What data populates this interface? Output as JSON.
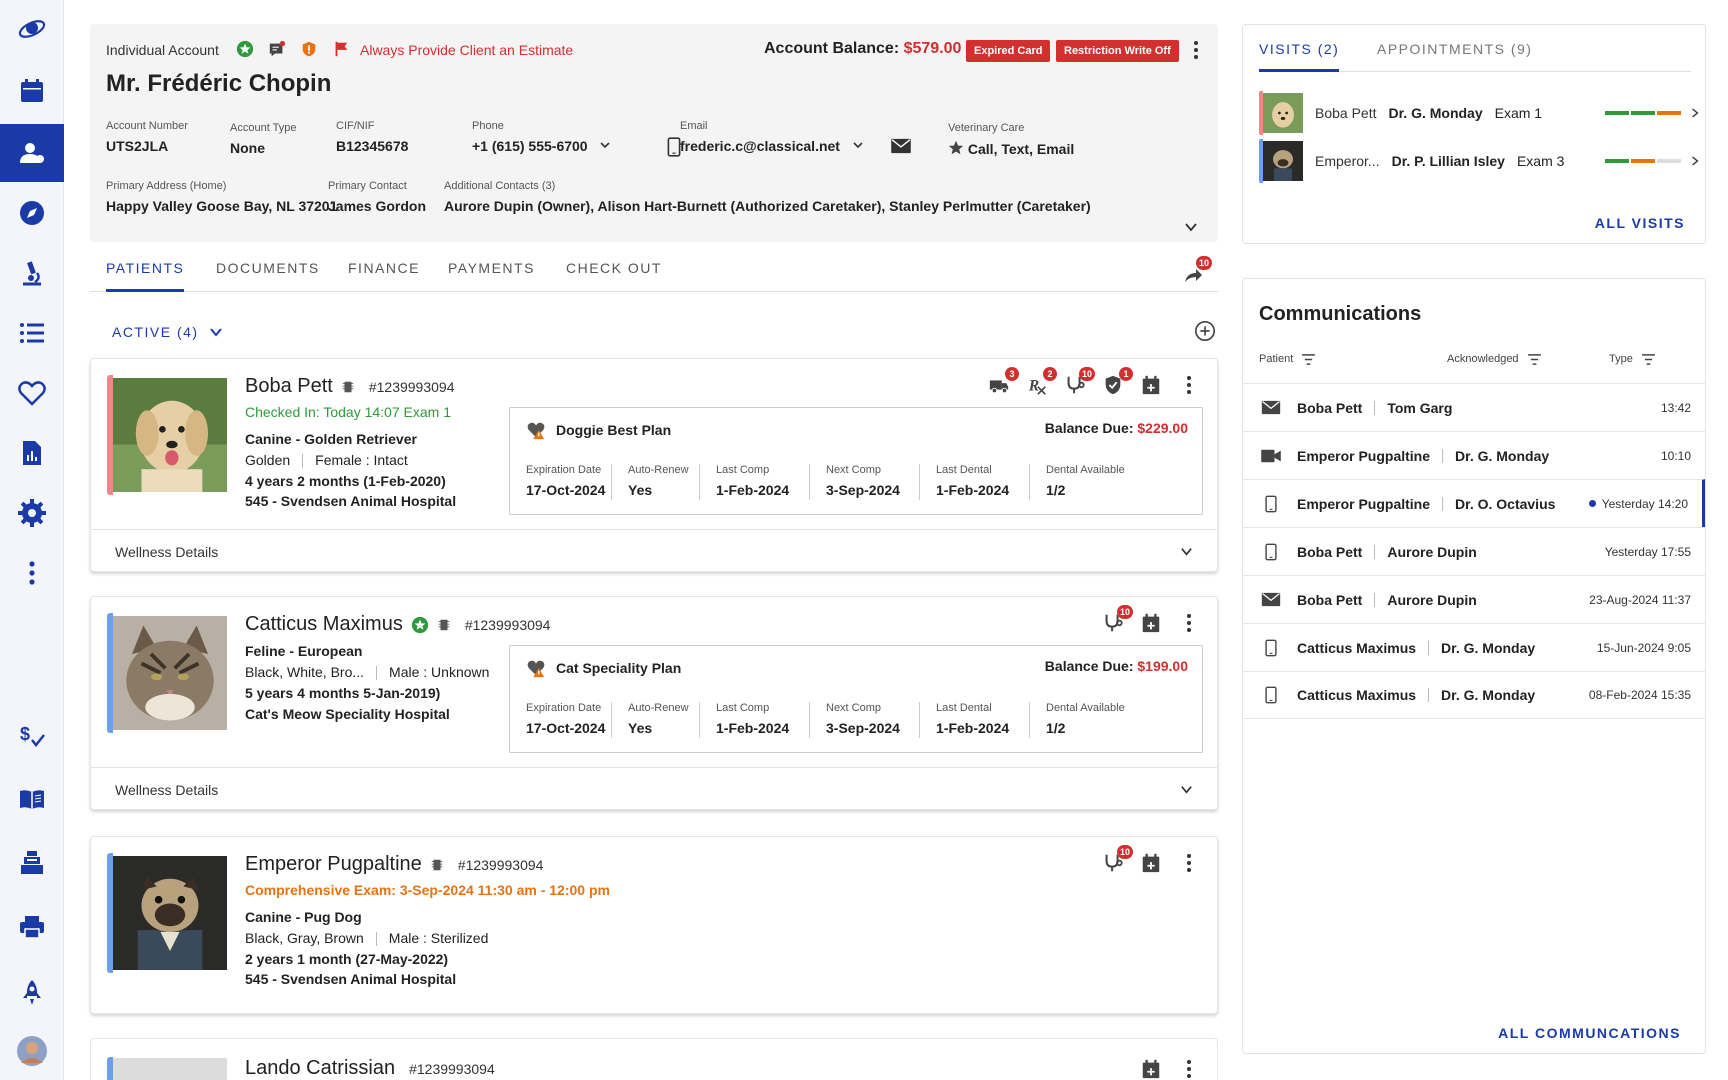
{
  "colors": {
    "brand": "#1a3aa8",
    "alert": "#d32f2f",
    "success": "#2e9a3c",
    "warning": "#e87312"
  },
  "nav": {
    "items": [
      "logo-icon",
      "calendar-icon",
      "client-icon",
      "compass-icon",
      "microscope-icon",
      "list-icon",
      "heart-icon",
      "report-icon",
      "settings-icon",
      "more-icon",
      "billing-icon",
      "library-icon",
      "register-icon",
      "printer-icon",
      "launch-icon",
      "avatar"
    ]
  },
  "account": {
    "type": "Individual Account",
    "estimate": "Always Provide Client an Estimate",
    "name": "Mr. Frédéric Chopin",
    "balance_label": "Account Balance:",
    "balance": "$579.00",
    "badge_expired": "Expired Card",
    "badge_restriction": "Restriction Write Off",
    "account_number_label": "Account Number",
    "account_number": "UTS2JLA",
    "account_type_label": "Account Type",
    "account_type": "None",
    "cif_label": "CIF/NIF",
    "cif": "B12345678",
    "phone_label": "Phone",
    "phone": "+1 (615) 555-6700",
    "email_label": "Email",
    "email": "frederic.c@classical.net",
    "vet_care_label": "Veterinary Care",
    "vet_care": "Call, Text, Email",
    "address_label": "Primary Address (Home)",
    "address": "Happy Valley Goose Bay, NL 37201",
    "primary_contact_label": "Primary Contact",
    "primary_contact": "James Gordon",
    "additional_contacts_label": "Additional Contacts (3)",
    "additional_contacts": "Aurore Dupin (Owner), Alison Hart-Burnett (Authorized Caretaker), Stanley Perlmutter (Caretaker)"
  },
  "tabs": [
    "PATIENTS",
    "DOCUMENTS",
    "FINANCE",
    "PAYMENTS",
    "CHECK OUT"
  ],
  "share_count": "10",
  "filter": "ACTIVE (4)",
  "patients": [
    {
      "name": "Boba Pett",
      "id": "#1239993094",
      "status": "Checked In: Today 14:07 Exam 1",
      "species": "Canine - Golden Retriever",
      "color": "Golden",
      "sex": "Female : Intact",
      "age": "4 years 2 months (1-Feb-2020)",
      "hospital": "545 - Svendsen Animal Hospital",
      "counts": {
        "truck": "3",
        "rx": "2",
        "stetho": "10",
        "shield": "1"
      },
      "plan": {
        "name": "Doggie Best Plan",
        "balance_label": "Balance Due:",
        "balance": "$229.00",
        "cols": [
          {
            "label": "Expiration Date",
            "value": "17-Oct-2024"
          },
          {
            "label": "Auto-Renew",
            "value": "Yes"
          },
          {
            "label": "Last Comp",
            "value": "1-Feb-2024"
          },
          {
            "label": "Next Comp",
            "value": "3-Sep-2024"
          },
          {
            "label": "Last Dental",
            "value": "1-Feb-2024"
          },
          {
            "label": "Dental Available",
            "value": "1/2"
          }
        ]
      },
      "wellness": "Wellness Details"
    },
    {
      "name": "Catticus Maximus",
      "id": "#1239993094",
      "species": "Feline - European",
      "color": "Black, White, Bro...",
      "sex": "Male : Unknown",
      "age": "5 years 4 months  5-Jan-2019)",
      "hospital": "Cat's Meow Speciality Hospital",
      "counts": {
        "stetho": "10"
      },
      "plan": {
        "name": "Cat Speciality Plan",
        "balance_label": "Balance Due:",
        "balance": "$199.00",
        "cols": [
          {
            "label": "Expiration Date",
            "value": "17-Oct-2024"
          },
          {
            "label": "Auto-Renew",
            "value": "Yes"
          },
          {
            "label": "Last Comp",
            "value": "1-Feb-2024"
          },
          {
            "label": "Next Comp",
            "value": "3-Sep-2024"
          },
          {
            "label": "Last Dental",
            "value": "1-Feb-2024"
          },
          {
            "label": "Dental Available",
            "value": "1/2"
          }
        ]
      },
      "wellness": "Wellness Details"
    },
    {
      "name": "Emperor Pugpaltine",
      "id": "#1239993094",
      "status": "Comprehensive Exam: 3-Sep-2024 11:30 am - 12:00 pm",
      "species": "Canine - Pug Dog",
      "color": "Black, Gray, Brown",
      "sex": "Male : Sterilized",
      "age": "2 years 1 month  (27-May-2022)",
      "hospital": "545 - Svendsen Animal Hospital",
      "counts": {
        "stetho": "10"
      }
    },
    {
      "name": "Lando Catrissian",
      "id": "#1239993094"
    }
  ],
  "visits": {
    "tab_visits": "VISITS (2)",
    "tab_appointments": "APPOINTMENTS (9)",
    "rows": [
      {
        "patient": "Boba Pett",
        "doctor": "Dr. G. Monday",
        "exam": "Exam 1",
        "progress": 0.75
      },
      {
        "patient": "Emperor...",
        "doctor": "Dr. P. Lillian Isley",
        "exam": "Exam 3",
        "progress": 0.5
      }
    ],
    "all_visits": "ALL VISITS"
  },
  "communications": {
    "title": "Communications",
    "col_patient": "Patient",
    "col_ack": "Acknowledged",
    "col_type": "Type",
    "rows": [
      {
        "icon": "mail-icon",
        "patient": "Boba Pett",
        "contact": "Tom Garg",
        "time": "13:42"
      },
      {
        "icon": "video-icon",
        "patient": "Emperor Pugpaltine",
        "contact": "Dr. G. Monday",
        "time": "10:10"
      },
      {
        "icon": "phone-icon",
        "patient": "Emperor Pugpaltine",
        "contact": "Dr. O. Octavius",
        "time": "Yesterday 14:20",
        "unread": true
      },
      {
        "icon": "phone-icon",
        "patient": "Boba Pett",
        "contact": "Aurore Dupin",
        "time": "Yesterday 17:55"
      },
      {
        "icon": "mail-icon",
        "patient": "Boba Pett",
        "contact": "Aurore Dupin",
        "time": "23-Aug-2024 11:37"
      },
      {
        "icon": "phone-icon",
        "patient": "Catticus Maximus",
        "contact": "Dr. G. Monday",
        "time": "15-Jun-2024 9:05"
      },
      {
        "icon": "phone-icon",
        "patient": "Catticus Maximus",
        "contact": "Dr. G. Monday",
        "time": "08-Feb-2024 15:35"
      }
    ],
    "all": "ALL COMMUNCATIONS"
  }
}
